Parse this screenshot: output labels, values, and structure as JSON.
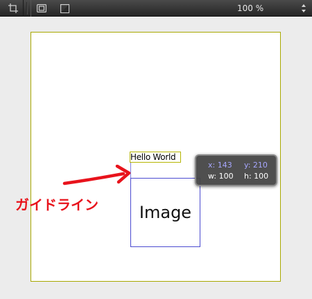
{
  "toolbar": {
    "tools": [
      {
        "name": "crop-align-tool"
      },
      {
        "name": "frame-tool"
      },
      {
        "name": "fill-tool"
      }
    ],
    "zoom_label": "100 %"
  },
  "canvas": {
    "text_layer": {
      "text": "Hello World"
    },
    "image_layer": {
      "label": "Image"
    },
    "info_hud": {
      "x_text": "x: 143",
      "y_text": "y: 210",
      "w_text": "w: 100",
      "h_text": "h: 100"
    }
  },
  "annotation": {
    "label": "ガイドライン",
    "color": "#e8131c"
  },
  "colors": {
    "toolbar_bg": "#2e2e2e",
    "canvas_bg": "#ececec",
    "artboard_border": "#a8a800",
    "image_border": "#4a4ad0",
    "hud_accent": "#a7a7ff"
  }
}
